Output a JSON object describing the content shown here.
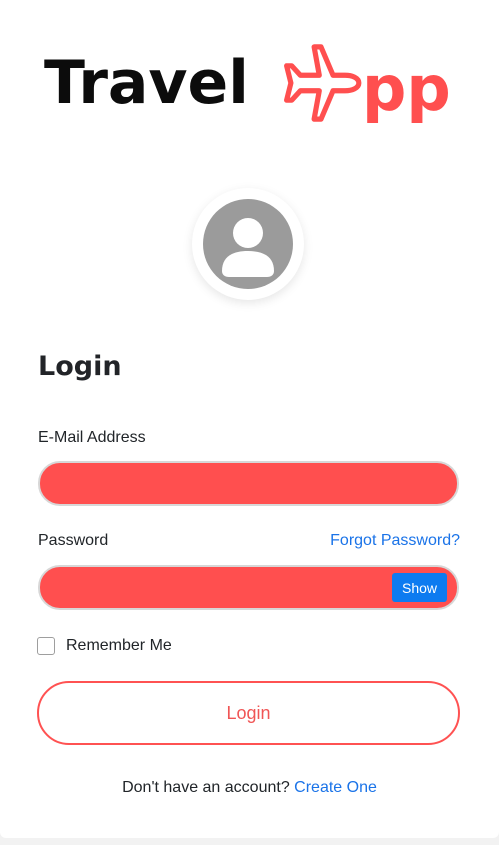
{
  "app": {
    "logo_text_1": "Travel",
    "logo_text_2": "pp",
    "logo_icon": "airplane-icon",
    "brand_color": "#ff4f4f"
  },
  "avatar": {
    "icon": "user-icon"
  },
  "form": {
    "title": "Login",
    "email_label": "E-Mail Address",
    "email_value": "",
    "password_label": "Password",
    "password_value": "",
    "forgot_label": "Forgot Password?",
    "show_label": "Show",
    "remember_label": "Remember Me",
    "remember_checked": false,
    "login_label": "Login"
  },
  "footer": {
    "prompt": "Don't have an account?",
    "create_label": "Create One"
  },
  "colors": {
    "field_fill": "#ff4f4f",
    "link": "#1a73e8",
    "show_button": "#0d7bf0",
    "login_border": "#ff5252"
  }
}
